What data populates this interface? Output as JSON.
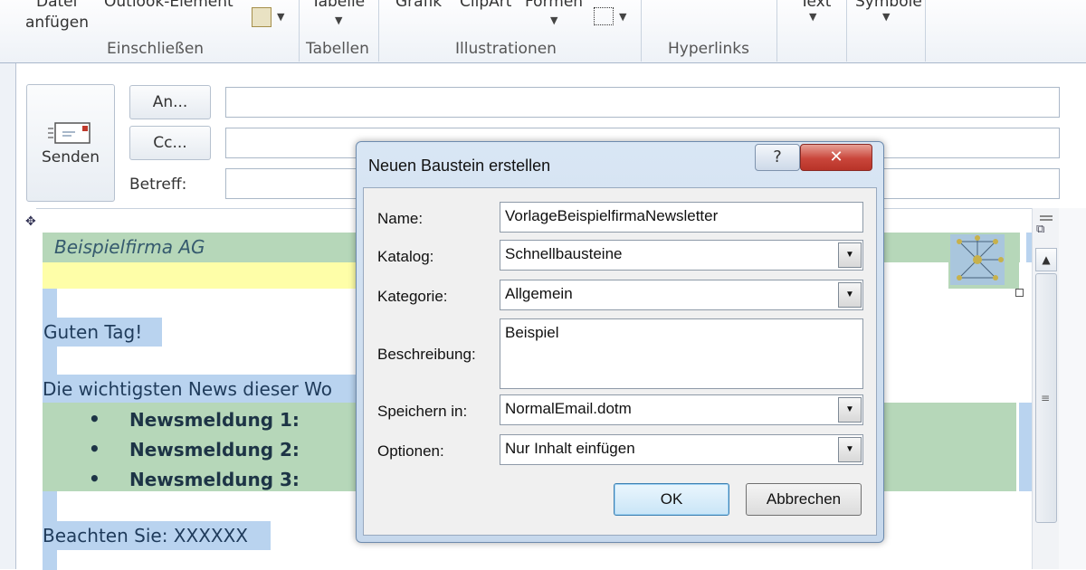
{
  "ribbon": {
    "top_labels": [
      "Datei",
      "Outlook-Element",
      "Tabelle",
      "Grafik",
      "ClipArt",
      "Formen",
      "Text",
      "Symbole"
    ],
    "attach": "anfügen",
    "groups": [
      "Einschließen",
      "Tabellen",
      "Illustrationen",
      "Hyperlinks"
    ]
  },
  "compose": {
    "send_label": "Senden",
    "to_button": "An...",
    "cc_button": "Cc...",
    "subject_label": "Betreff:"
  },
  "body": {
    "company": "Beispielfirma AG",
    "greeting": "Guten Tag!",
    "news_heading": "Die wichtigsten News dieser Wo",
    "news_items": [
      "Newsmeldung 1:",
      "Newsmeldung 2:",
      "Newsmeldung 3:"
    ],
    "note": "Beachten Sie: XXXXXX"
  },
  "dialog": {
    "title": "Neuen Baustein erstellen",
    "help": "?",
    "close": "✕",
    "labels": {
      "name": "Name:",
      "catalog": "Katalog:",
      "category": "Kategorie:",
      "description": "Beschreibung:",
      "save_in": "Speichern in:",
      "options": "Optionen:"
    },
    "values": {
      "name": "VorlageBeispielfirmaNewsletter",
      "catalog": "Schnellbausteine",
      "category": "Allgemein",
      "description": "Beispiel",
      "save_in": "NormalEmail.dotm",
      "options": "Nur Inhalt einfügen"
    },
    "ok": "OK",
    "cancel": "Abbrechen"
  }
}
